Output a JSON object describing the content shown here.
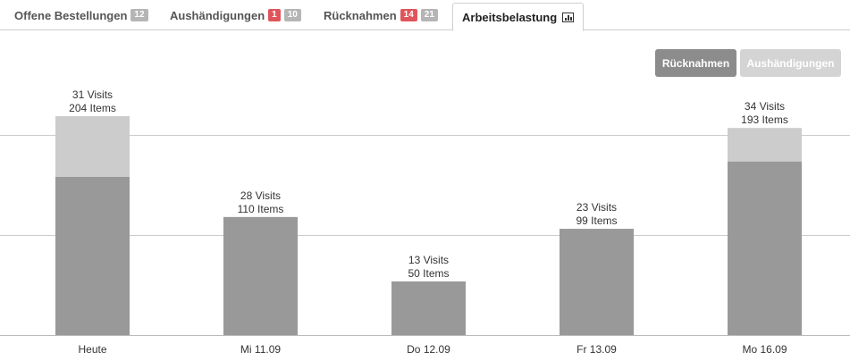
{
  "tabs": [
    {
      "label": "Offene Bestellungen",
      "badges": [
        {
          "text": "12",
          "color": "gray"
        }
      ]
    },
    {
      "label": "Aushändigungen",
      "badges": [
        {
          "text": "1",
          "color": "red"
        },
        {
          "text": "10",
          "color": "gray"
        }
      ]
    },
    {
      "label": "Rücknahmen",
      "badges": [
        {
          "text": "14",
          "color": "red"
        },
        {
          "text": "21",
          "color": "gray"
        }
      ]
    },
    {
      "label": "Arbeitsbelastung",
      "icon": "bar-chart-icon",
      "active": true
    }
  ],
  "toggles": {
    "returns_label": "Rücknahmen",
    "handovers_label": "Aushändigungen",
    "active": "returns"
  },
  "colors": {
    "visits_segment": "#999999",
    "items_segment": "#cccccc",
    "toggle_on": "#8c8c8c",
    "toggle_off": "#d4d4d4",
    "badge_red": "#e0555b",
    "badge_gray": "#b5b5b5"
  },
  "chart_data": {
    "type": "bar",
    "stacked": true,
    "categories": [
      "Heute",
      "Mi 11.09",
      "Do 12.09",
      "Fr 13.09",
      "Mo 16.09"
    ],
    "visits": [
      31,
      28,
      13,
      23,
      34
    ],
    "items": [
      204,
      110,
      50,
      99,
      193
    ],
    "visits_labels": [
      "31 Visits",
      "28 Visits",
      "13 Visits",
      "23 Visits",
      "34 Visits"
    ],
    "items_labels": [
      "204 Items",
      "110 Items",
      "50 Items",
      "99 Items",
      "193 Items"
    ],
    "grid": true
  }
}
